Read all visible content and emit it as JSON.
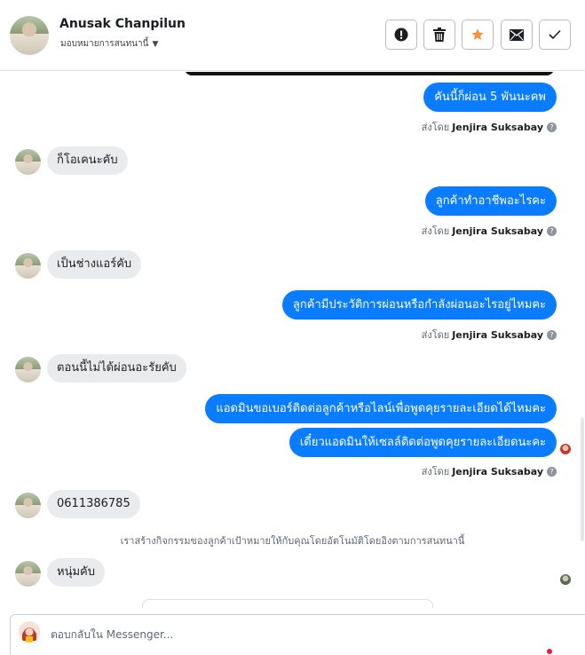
{
  "header": {
    "name": "Anusak Chanpilun",
    "assign_label": "มอบหมายการสนทนานี้",
    "tools": [
      "report-icon",
      "trash-icon",
      "star-icon",
      "mail-icon",
      "check-icon"
    ],
    "star_color": "#f7923b"
  },
  "messages": {
    "out1": "คันนี้ก็ผ่อน 5 พันนะคพ",
    "in1": "ก็โอเคนะคับ",
    "out2": "ลูกค้าทำอาชีพอะไรคะ",
    "in2": "เป็นช่างแอร์คับ",
    "out3": "ลูกค้ามีประวัติการผ่อนหรือกำลังผ่อนอะไรอยู่ไหมคะ",
    "in3": "ตอนนี้ไม่ได้ผ่อนอะรัยคับ",
    "out4": "แอดมินขอเบอร์ติดต่อลูกค้าหรือไลน์เพื่อพูดคุยรายละเอียดได้ไหมคะ",
    "out5": "เดี๋ยวแอดมินให้เซลล์ติดต่อพูดคุยรายละเอียดนะคะ",
    "in4": "0611386785",
    "in5": "หนุ่มคับ"
  },
  "sent_by": {
    "prefix": "ส่งโดย",
    "agent": "Jenjira Suksabay"
  },
  "notice": "เราสร้างกิจกรรมของลูกค้าเป้าหมายให้กับคุณโดยอัตโนมัติโดยอิงตามการสนทนานี้",
  "composer": {
    "placeholder": "ตอบกลับใน Messenger..."
  },
  "colors": {
    "outgoing": "#0a7cff",
    "incoming": "#eaebed"
  }
}
